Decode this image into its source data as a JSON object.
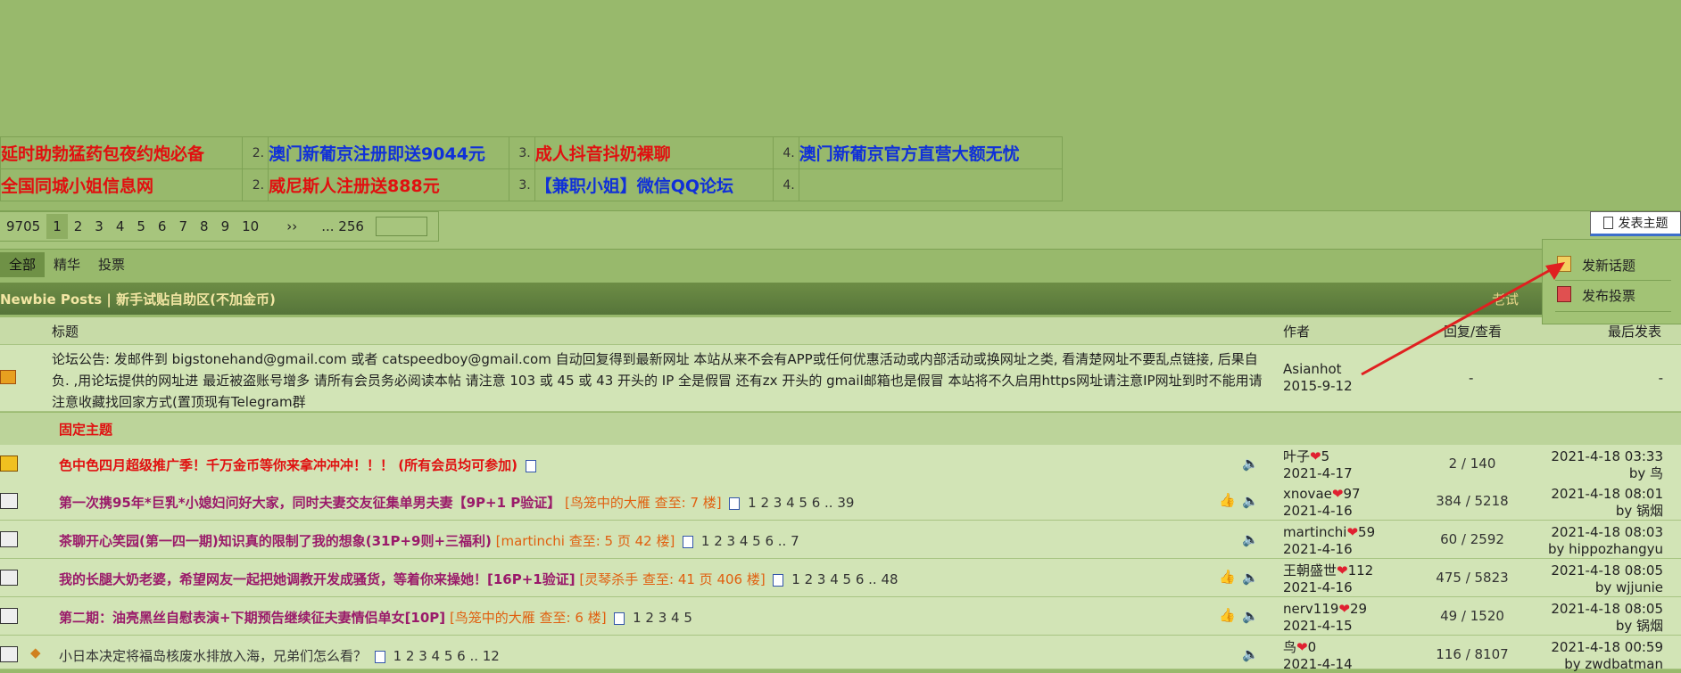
{
  "ads": [
    [
      "延时助勃猛药包夜约炮必备",
      "2.",
      "澳门新葡京注册即送9044元",
      "3.",
      "成人抖音抖奶裸聊",
      "4.",
      "澳门新葡京官方直营大额无忧"
    ],
    [
      "全国同城小姐信息网",
      "2.",
      "威尼斯人注册送888元",
      "3.",
      "【兼职小姐】微信QQ论坛",
      "4.",
      ""
    ]
  ],
  "pager": {
    "total": "9705",
    "pages": [
      "1",
      "2",
      "3",
      "4",
      "5",
      "6",
      "7",
      "8",
      "9",
      "10"
    ],
    "next": "››",
    "last": "... 256"
  },
  "newpost_btn": "发表主题",
  "tabs": [
    "全部",
    "精华",
    "投票"
  ],
  "forum_title": "Newbie Posts | 新手试贴自助区(不加金币)",
  "forum_right": "老试",
  "dropdown": {
    "new_topic": "发新话题",
    "new_poll": "发布投票"
  },
  "columns": {
    "title": "标题",
    "author": "作者",
    "replies": "回复/查看",
    "last": "最后发表"
  },
  "announcement": {
    "text": "论坛公告: 发邮件到 bigstonehand@gmail.com 或者 catspeedboy@gmail.com 自动回复得到最新网址 本站从来不会有APP或任何优惠活动或内部活动或换网址之类, 看清楚网址不要乱点链接, 后果自负. ,用论坛提供的网址进 最近被盗账号增多 请所有会员务必阅读本帖 请注意 103 或 45 或 43 开头的 IP 全是假冒 还有zx 开头的 gmail邮箱也是假冒 本站将不久启用https网址请注意IP网址到时不能用请注意收藏找回家方式(置顶现有Telegram群",
    "author": "Asianhot",
    "date": "2015-9-12",
    "replies": "-",
    "last": "-"
  },
  "pinned_label": "固定主题",
  "rows": [
    {
      "title": "色中色四月超级推广季！千万金币等你来拿冲冲冲！！！ (所有会员均可参加)",
      "guide": "",
      "pages": "",
      "author": "叶子",
      "author_num": "5",
      "date": "2021-4-17",
      "rv": "2 / 140",
      "last_time": "2021-4-18 03:33",
      "last_by": "by 鸟"
    },
    {
      "title": "第一次携95年*巨乳*小媳妇问好大家，同时夫妻交友征集单男夫妻【9P+1 P验证】",
      "guide": "[鸟笼中的大雁 查至: 7 楼]",
      "pages": "1  2  3  4  5  6 ..  39",
      "author": "xnovae",
      "author_num": "97",
      "date": "2021-4-16",
      "rv": "384 / 5218",
      "last_time": "2021-4-18 08:01",
      "last_by": "by 锅烟"
    },
    {
      "title": "茶聊开心笑园(第一四一期)知识真的限制了我的想象(31P+9则+三福利)",
      "guide": "[martinchi 查至: 5 页 42 楼]",
      "pages": "1  2  3  4  5  6 ..  7",
      "author": "martinchi",
      "author_num": "59",
      "date": "2021-4-16",
      "rv": "60 / 2592",
      "last_time": "2021-4-18 08:03",
      "last_by": "by hippozhangyu"
    },
    {
      "title": "我的长腿大奶老婆，希望网友一起把她调教开发成骚货，等着你来操她！[16P+1验证]",
      "guide": "[灵琴杀手 查至: 41 页 406 楼]",
      "pages": "1  2  3  4  5  6 ..  48",
      "author": "王朝盛世",
      "author_num": "112",
      "date": "2021-4-16",
      "rv": "475 / 5823",
      "last_time": "2021-4-18 08:05",
      "last_by": "by wjjunie"
    },
    {
      "title": "第二期：油亮黑丝自慰表演+下期预告继续征夫妻情侣单女[10P]",
      "guide": "[鸟笼中的大雁 查至: 6 楼]",
      "pages": "1  2  3  4  5",
      "author": "nerv119",
      "author_num": "29",
      "date": "2021-4-15",
      "rv": "49 / 1520",
      "last_time": "2021-4-18 08:05",
      "last_by": "by 锅烟"
    },
    {
      "title": "小日本决定将福岛核废水排放入海，兄弟们怎么看？",
      "guide": "",
      "pages": "1  2  3  4  5  6 ..  12",
      "author": "鸟",
      "author_num": "0",
      "date": "2021-4-14",
      "rv": "116 / 8107",
      "last_time": "2021-4-18 00:59",
      "last_by": "by zwdbatman"
    }
  ]
}
